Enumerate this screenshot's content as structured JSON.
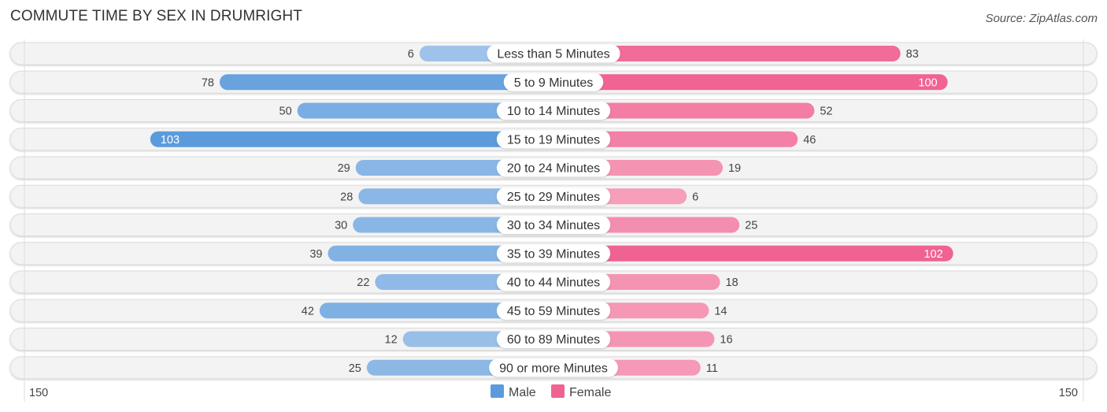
{
  "header": {
    "title": "COMMUTE TIME BY SEX IN DRUMRIGHT",
    "source": "Source: ZipAtlas.com"
  },
  "chart_data": {
    "type": "bar",
    "orientation": "horizontal-diverging",
    "title": "COMMUTE TIME BY SEX IN DRUMRIGHT",
    "categories": [
      "Less than 5 Minutes",
      "5 to 9 Minutes",
      "10 to 14 Minutes",
      "15 to 19 Minutes",
      "20 to 24 Minutes",
      "25 to 29 Minutes",
      "30 to 34 Minutes",
      "35 to 39 Minutes",
      "40 to 44 Minutes",
      "45 to 59 Minutes",
      "60 to 89 Minutes",
      "90 or more Minutes"
    ],
    "series": [
      {
        "name": "Male",
        "side": "left",
        "color": "#5b9bdb",
        "light_color": "#a9c9ec",
        "values": [
          6,
          78,
          50,
          103,
          29,
          28,
          30,
          39,
          22,
          42,
          12,
          25
        ]
      },
      {
        "name": "Female",
        "side": "right",
        "color": "#f06292",
        "light_color": "#f7a8c0",
        "values": [
          83,
          100,
          52,
          46,
          19,
          6,
          25,
          102,
          18,
          14,
          16,
          11
        ]
      }
    ],
    "axis": {
      "left_max": 150,
      "right_max": 150,
      "left_tick_label": "150",
      "right_tick_label": "150"
    },
    "legend": {
      "position": "bottom-center",
      "items": [
        "Male",
        "Female"
      ]
    },
    "grid": false
  }
}
